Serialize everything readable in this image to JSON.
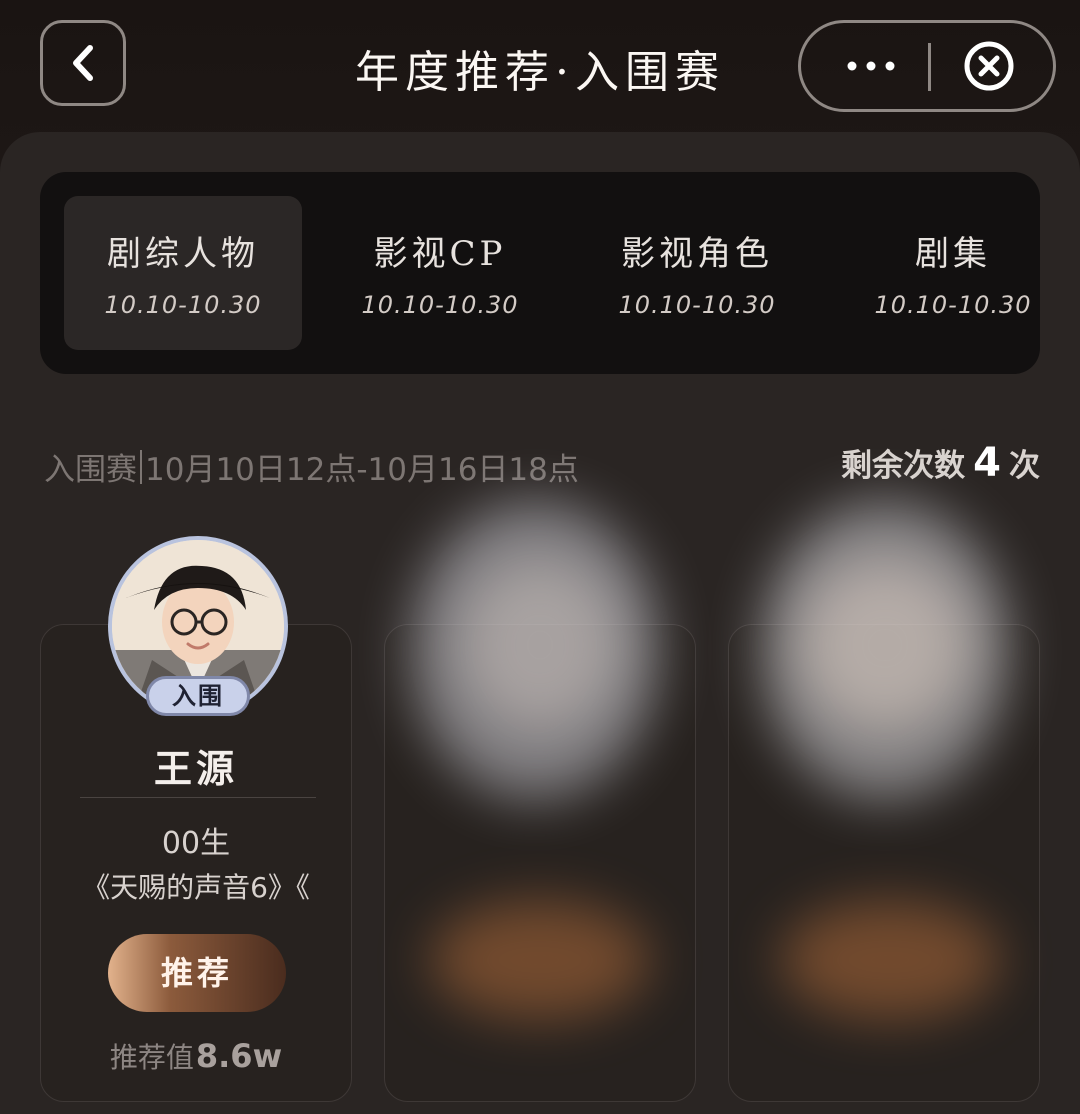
{
  "header": {
    "title": "年度推荐·入围赛",
    "back_icon": "chevron-left-icon",
    "more_icon": "more-dots-icon",
    "close_icon": "close-circle-icon"
  },
  "tabs": [
    {
      "label": "剧综人物",
      "date": "10.10-10.30",
      "active": true
    },
    {
      "label": "影视CP",
      "date": "10.10-10.30",
      "active": false
    },
    {
      "label": "影视角色",
      "date": "10.10-10.30",
      "active": false
    },
    {
      "label": "剧集",
      "date": "10.10-10.30",
      "active": false
    }
  ],
  "round": {
    "name": "入围赛",
    "period": "10月10日12点-10月16日18点",
    "remaining_label": "剩余次数",
    "remaining_count": "4",
    "remaining_unit": "次"
  },
  "candidates": [
    {
      "status_tag": "入围",
      "name": "王源",
      "birth": "00生",
      "works": "《天赐的声音6》《",
      "button_label": "推荐",
      "score_label": "推荐值",
      "score_value": "8.6w"
    }
  ],
  "colors": {
    "background": "#1b1716",
    "panel": "#2a2523",
    "tab_bar": "#121010",
    "button_gold": "#8c5b3c",
    "tag_blue": "#c9d1ea"
  }
}
